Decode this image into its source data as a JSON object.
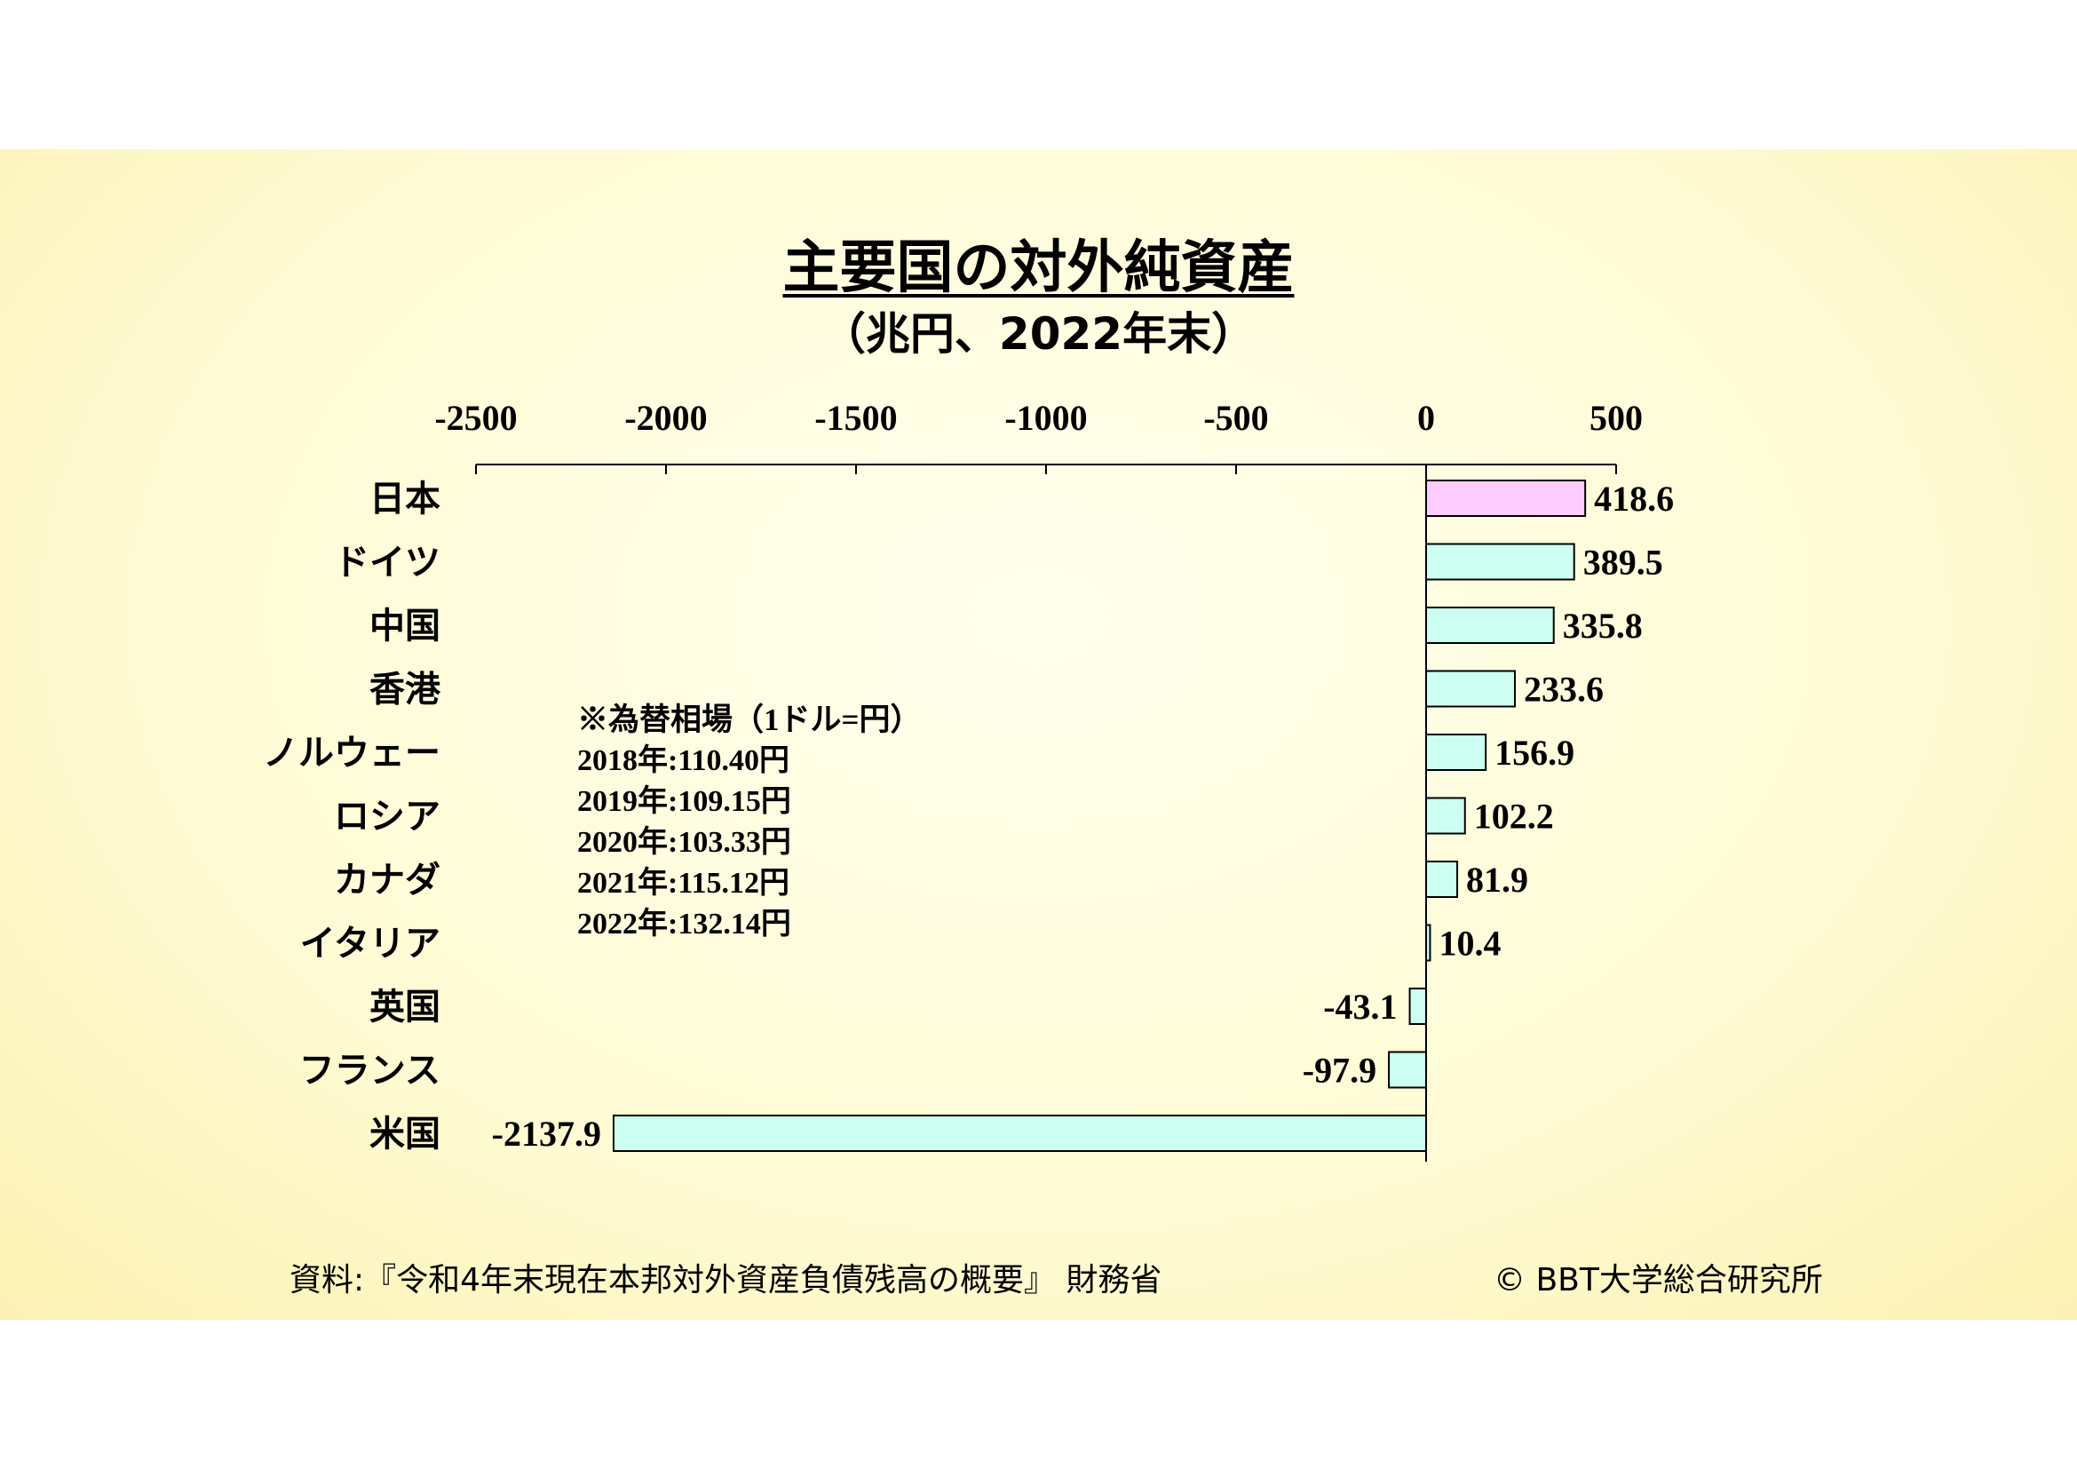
{
  "title": "主要国の対外純資産",
  "subtitle": "（兆円、2022年末）",
  "note": {
    "heading": "※為替相場（1ドル=円）",
    "lines": [
      "2018年:110.40円",
      "2019年:109.15円",
      "2020年:103.33円",
      "2021年:115.12円",
      "2022年:132.14円"
    ]
  },
  "footer": {
    "source": "資料:『令和4年末現在本邦対外資産負債残高の概要』 財務省",
    "copyright": "© BBT大学総合研究所"
  },
  "colors": {
    "japan_bar": "#ffccff",
    "other_bars": "#ccfff2",
    "bar_stroke": "#000000"
  },
  "chart_data": {
    "type": "bar",
    "orientation": "horizontal",
    "categories": [
      "日本",
      "ドイツ",
      "中国",
      "香港",
      "ノルウェー",
      "ロシア",
      "カナダ",
      "イタリア",
      "英国",
      "フランス",
      "米国"
    ],
    "values": [
      418.6,
      389.5,
      335.8,
      233.6,
      156.9,
      102.2,
      81.9,
      10.4,
      -43.1,
      -97.9,
      -2137.9
    ],
    "data_labels": [
      "418.6",
      "389.5",
      "335.8",
      "233.6",
      "156.9",
      "102.2",
      "81.9",
      "10.4",
      "-43.1",
      "-97.9",
      "-2137.9"
    ],
    "xlim": [
      -2500,
      500
    ],
    "xticks": [
      -2500,
      -2000,
      -1500,
      -1000,
      -500,
      0,
      500
    ],
    "xtick_labels": [
      "-2500",
      "-2000",
      "-1500",
      "-1000",
      "-500",
      "0",
      "500"
    ],
    "axis_position": "top",
    "grid": false,
    "legend": false
  }
}
